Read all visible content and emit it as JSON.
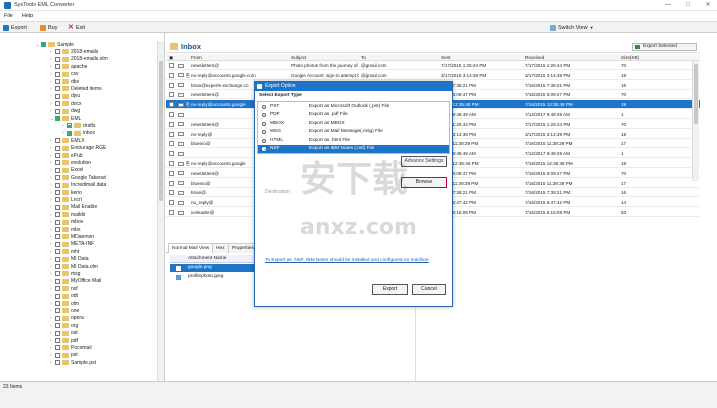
{
  "window": {
    "title": "SysTools EML Converter",
    "minimize": "—",
    "maximize": "□",
    "close": "✕"
  },
  "menu": [
    "File",
    "Help"
  ],
  "toolbar": {
    "export": "Export",
    "buy": "Buy",
    "exit": "Exit",
    "switch_view": "Switch View",
    "export_selected": "Export Selected"
  },
  "tree": [
    {
      "label": "Sample",
      "depth": 0,
      "checked": true
    },
    {
      "label": "2018-emails",
      "depth": 2,
      "checked": false
    },
    {
      "label": "2018-emails.olm",
      "depth": 2,
      "checked": false
    },
    {
      "label": "apache",
      "depth": 2,
      "checked": false
    },
    {
      "label": "csv",
      "depth": 2,
      "checked": false
    },
    {
      "label": "dbx",
      "depth": 2,
      "checked": false
    },
    {
      "label": "Deleted items",
      "depth": 2,
      "checked": false
    },
    {
      "label": "djvu",
      "depth": 2,
      "checked": false
    },
    {
      "label": "docx",
      "depth": 2,
      "checked": false
    },
    {
      "label": "dwg",
      "depth": 2,
      "checked": false
    },
    {
      "label": "EML",
      "depth": 2,
      "checked": true
    },
    {
      "label": "drafts",
      "depth": 3,
      "checked": true
    },
    {
      "label": "inbox",
      "depth": 3,
      "checked": true
    },
    {
      "label": "EMLX",
      "depth": 2,
      "checked": false
    },
    {
      "label": "Entourage RGE",
      "depth": 2,
      "checked": false
    },
    {
      "label": "ePub",
      "depth": 2,
      "checked": false
    },
    {
      "label": "evolution",
      "depth": 2,
      "checked": false
    },
    {
      "label": "Excel",
      "depth": 2,
      "checked": false
    },
    {
      "label": "Google Takeout",
      "depth": 2,
      "checked": false
    },
    {
      "label": "Incredimail data",
      "depth": 2,
      "checked": false
    },
    {
      "label": "kerio",
      "depth": 2,
      "checked": false
    },
    {
      "label": "Lncrl",
      "depth": 2,
      "checked": false
    },
    {
      "label": "Mail Enable",
      "depth": 2,
      "checked": false
    },
    {
      "label": "maildir",
      "depth": 2,
      "checked": false
    },
    {
      "label": "mbox",
      "depth": 2,
      "checked": false
    },
    {
      "label": "mbx",
      "depth": 2,
      "checked": false
    },
    {
      "label": "MDaemon",
      "depth": 2,
      "checked": false
    },
    {
      "label": "META-INF",
      "depth": 2,
      "checked": false
    },
    {
      "label": "mht",
      "depth": 2,
      "checked": false
    },
    {
      "label": "MI Data",
      "depth": 2,
      "checked": false
    },
    {
      "label": "MI Data.olm",
      "depth": 2,
      "checked": false
    },
    {
      "label": "msg",
      "depth": 2,
      "checked": false
    },
    {
      "label": "MyOffice Mail",
      "depth": 2,
      "checked": false
    },
    {
      "label": "nsf",
      "depth": 2,
      "checked": false
    },
    {
      "label": "odt",
      "depth": 2,
      "checked": false
    },
    {
      "label": "olm",
      "depth": 2,
      "checked": false
    },
    {
      "label": "one",
      "depth": 2,
      "checked": false
    },
    {
      "label": "opera",
      "depth": 2,
      "checked": false
    },
    {
      "label": "org",
      "depth": 2,
      "checked": false
    },
    {
      "label": "ost",
      "depth": 2,
      "checked": false
    },
    {
      "label": "pdf",
      "depth": 2,
      "checked": false
    },
    {
      "label": "Pocomail",
      "depth": 2,
      "checked": false
    },
    {
      "label": "pst",
      "depth": 2,
      "checked": false
    },
    {
      "label": "Sample.pst",
      "depth": 2,
      "checked": false
    }
  ],
  "inbox": {
    "title": "Inbox"
  },
  "columns": [
    "From",
    "Subject",
    "To",
    "Sent",
    "Received",
    "Size(KB)"
  ],
  "rows": [
    {
      "from": "newsletters@",
      "subject": "Photo photos from the journey of ...",
      "to": "@gmail.com",
      "sent": "7/17/2015 1:25:44 PM",
      "received": "7/17/2015 1:25:44 PM",
      "size": "70",
      "attach": false,
      "selected": false
    },
    {
      "from": "no-reply@accounts.google.com",
      "subject": "Google Account: sign-in attempt b...",
      "to": "@gmail.com",
      "sent": "3/17/2015 3:14:39 PM",
      "received": "3/17/2015 3:14:39 PM",
      "size": "19",
      "attach": true,
      "selected": false
    },
    {
      "from": "brian@experts-exchange.co",
      "subject": "",
      "to": "",
      "sent": "2015 7:38:21 PM",
      "received": "7/16/2015 7:38:21 PM",
      "size": "16",
      "attach": false,
      "selected": false
    },
    {
      "from": "newsletters@",
      "subject": "",
      "to": "",
      "sent": "2015 6:09:47 PM",
      "received": "7/16/2015 6:09:47 PM",
      "size": "70",
      "attach": false,
      "selected": false
    },
    {
      "from": "no-reply@accounts.google",
      "subject": "",
      "to": "",
      "sent": "2015 12:35:48 PM",
      "received": "7/16/2015 12:35:48 PM",
      "size": "19",
      "attach": true,
      "selected": true
    },
    {
      "from": "",
      "subject": "",
      "to": "",
      "sent": "2017 9:48:49 AM",
      "received": "7/12/2017 9:48:49 AM",
      "size": "1",
      "attach": false,
      "selected": false
    },
    {
      "from": "newsletters@",
      "subject": "",
      "to": "",
      "sent": "2015 1:25:44 PM",
      "received": "7/17/2015 1:25:44 PM",
      "size": "70",
      "attach": false,
      "selected": false
    },
    {
      "from": "no-reply@",
      "subject": "",
      "to": "",
      "sent": "2015 3:14:39 PM",
      "received": "3/17/2015 3:14:39 PM",
      "size": "19",
      "attach": false,
      "selected": false
    },
    {
      "from": "bluenio@",
      "subject": "",
      "to": "",
      "sent": "2015 11:39:39 PM",
      "received": "7/16/2015 11:39:39 PM",
      "size": "17",
      "attach": false,
      "selected": false
    },
    {
      "from": "",
      "subject": "",
      "to": "",
      "sent": "2017 9:48:49 AM",
      "received": "7/12/2017 9:48:49 AM",
      "size": "1",
      "attach": false,
      "selected": false
    },
    {
      "from": "no-reply@accounts.google",
      "subject": "",
      "to": "",
      "sent": "2015 12:35:48 PM",
      "received": "7/16/2015 12:35:48 PM",
      "size": "19",
      "attach": true,
      "selected": false
    },
    {
      "from": "newsletters@",
      "subject": "",
      "to": "",
      "sent": "2015 6:09:47 PM",
      "received": "7/16/2015 6:09:47 PM",
      "size": "70",
      "attach": false,
      "selected": false
    },
    {
      "from": "bluenio@",
      "subject": "",
      "to": "",
      "sent": "2015 11:39:39 PM",
      "received": "7/16/2015 11:39:39 PM",
      "size": "17",
      "attach": false,
      "selected": false
    },
    {
      "from": "brian@",
      "subject": "",
      "to": "",
      "sent": "2015 7:38:21 PM",
      "received": "7/16/2015 7:38:21 PM",
      "size": "16",
      "attach": false,
      "selected": false
    },
    {
      "from": "no_reply@",
      "subject": "",
      "to": "",
      "sent": "2015 6:47:42 PM",
      "received": "7/16/2015 6:47:42 PM",
      "size": "14",
      "attach": false,
      "selected": false
    },
    {
      "from": "iceleader@",
      "subject": "",
      "to": "",
      "sent": "2015 6:15:09 PM",
      "received": "7/16/2015 6:15:09 PM",
      "size": "53",
      "attach": false,
      "selected": false
    }
  ],
  "tabs": [
    "Normal Mail View",
    "Hex",
    "Properties"
  ],
  "attachments": {
    "header": "Attachment Name",
    "items": [
      "google.png",
      "profilephoto.jpeg"
    ]
  },
  "dialog": {
    "title": "Export Option",
    "section": "Select Export Type",
    "options": [
      {
        "name": "PST",
        "desc": "Export as Microsoft Outlook (.pst) File",
        "selected": false
      },
      {
        "name": "PDF",
        "desc": "Export as .pdf File",
        "selected": false
      },
      {
        "name": "MBOX",
        "desc": "Export as MBOX",
        "selected": false
      },
      {
        "name": "MSG",
        "desc": "Export as Mail Message(.msg) File",
        "selected": false
      },
      {
        "name": "HTML",
        "desc": "Export as .html File",
        "selected": false
      },
      {
        "name": "NSF",
        "desc": "Export as IBM Notes (.nsf) File",
        "selected": true
      }
    ],
    "destination_label": "Destination",
    "advance_settings": "Advance Settings",
    "browse": "Browse",
    "note": "To Export as .NSF, IBM Notes should be installed and configured on machine",
    "export": "Export",
    "cancel": "Cancel"
  },
  "status": {
    "items": "23 Items"
  }
}
